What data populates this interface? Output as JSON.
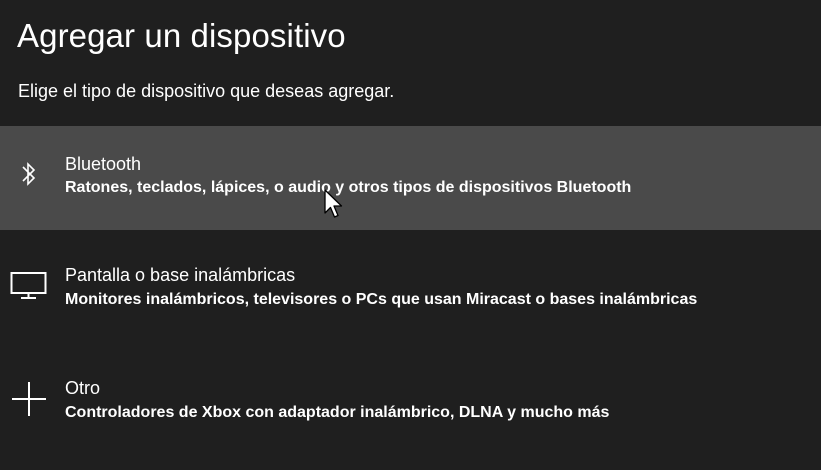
{
  "page": {
    "title": "Agregar un dispositivo",
    "subtitle": "Elige el tipo de dispositivo que deseas agregar."
  },
  "options": [
    {
      "icon": "bluetooth-icon",
      "name": "Bluetooth",
      "description": "Ratones, teclados, lápices, o audio y otros tipos de dispositivos Bluetooth",
      "hovered": true
    },
    {
      "icon": "monitor-icon",
      "name": "Pantalla o base inalámbricas",
      "description": "Monitores inalámbricos, televisores o PCs que usan Miracast o bases inalámbricas",
      "hovered": false
    },
    {
      "icon": "plus-icon",
      "name": "Otro",
      "description": "Controladores de Xbox con adaptador inalámbrico, DLNA y mucho más",
      "hovered": false
    }
  ],
  "colors": {
    "background": "#1f1f1f",
    "hover_background": "#4a4a4a",
    "text": "#ffffff"
  }
}
